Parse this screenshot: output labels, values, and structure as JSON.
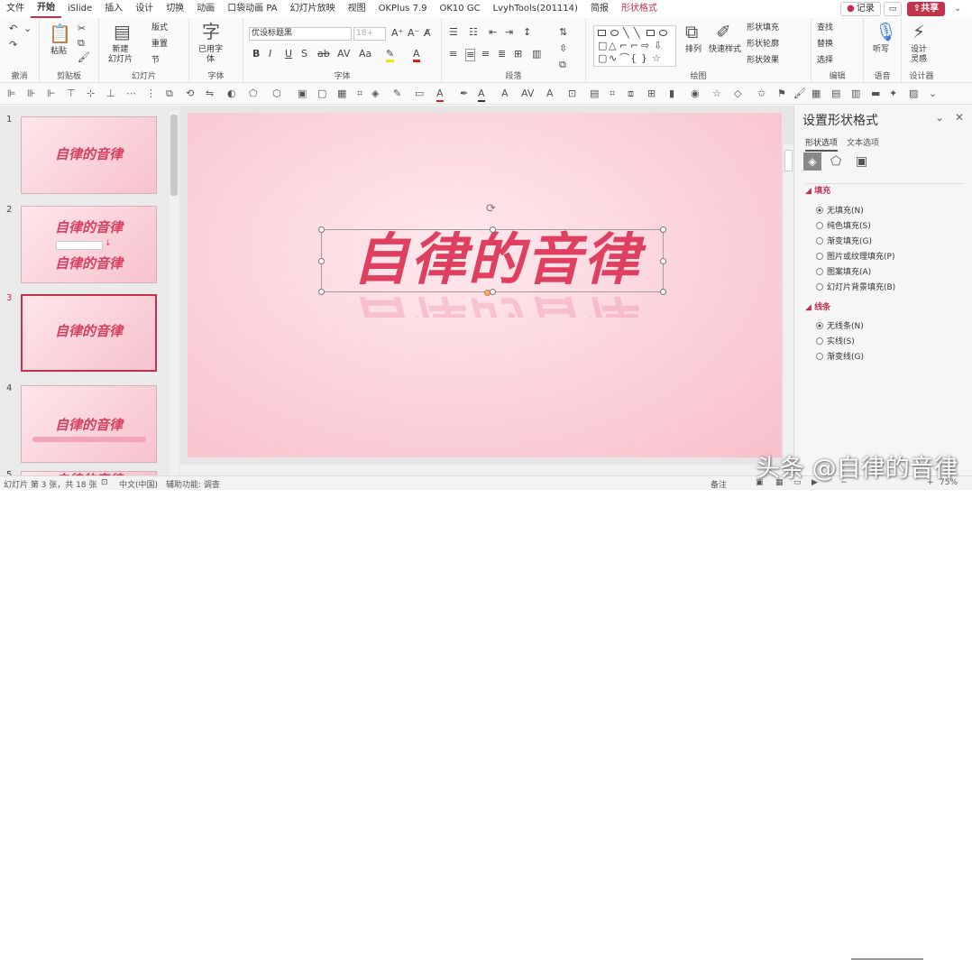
{
  "menu": {
    "tabs": [
      "文件",
      "开始",
      "iSlide",
      "插入",
      "设计",
      "切换",
      "动画",
      "口袋动画 PA",
      "幻灯片放映",
      "视图",
      "OKPlus 7.9",
      "OK10 GC",
      "LvyhTools(201114)",
      "简报",
      "形状格式"
    ],
    "record_label": "记录",
    "share_label": "共享",
    "more": "⌄"
  },
  "ribbon": {
    "groups": {
      "undo": "撤消",
      "clipboard": "剪贴板",
      "slides": "幻灯片",
      "font": "字体",
      "font_main": "字体",
      "paragraph": "段落",
      "drawing": "绘图",
      "editing": "编辑",
      "voice": "语音",
      "designer": "设计器"
    },
    "paste": "粘贴",
    "new_slide": "新建\n幻灯片",
    "layout": "版式",
    "reset": "重置",
    "section": "节",
    "font_name": "优设标题黑",
    "font_size": "18+",
    "used_font": "已用字\n体",
    "arrange": "排列",
    "quick_styles": "快速样式",
    "shape_fill": "形状填充",
    "shape_outline": "形状轮廓",
    "shape_effects": "形状效果",
    "find": "查找",
    "replace": "替换",
    "select": "选择",
    "dictate": "听写",
    "design_ideas": "设计\n灵感"
  },
  "slides": [
    {
      "num": "1",
      "title": "自律的音律"
    },
    {
      "num": "2",
      "title": "自律的音律",
      "title2": "自律的音律"
    },
    {
      "num": "3",
      "title": "自律的音律",
      "selected": true
    },
    {
      "num": "4",
      "title": "自律的音律"
    },
    {
      "num": "5",
      "title": "自律的音律"
    }
  ],
  "canvas": {
    "title": "自律的音律"
  },
  "pane": {
    "title": "设置形状格式",
    "tab_shape": "形状选项",
    "tab_text": "文本选项",
    "fill_section": "填充",
    "fill_options": [
      "无填充(N)",
      "纯色填充(S)",
      "渐变填充(G)",
      "图片或纹理填充(P)",
      "图案填充(A)",
      "幻灯片背景填充(B)"
    ],
    "line_section": "线条",
    "line_options": [
      "无线条(N)",
      "实线(S)",
      "渐变线(G)"
    ]
  },
  "status": {
    "slide_info": "幻灯片 第 3 张，共 18 张",
    "language": "中文(中国)",
    "accessibility": "辅助功能: 调查",
    "notes": "备注",
    "zoom": "75%"
  },
  "watermark": "头条 @自律的音律",
  "colors": {
    "accent": "#c4314b",
    "title": "#e0405f",
    "slide_bg": "#fbd2da"
  }
}
